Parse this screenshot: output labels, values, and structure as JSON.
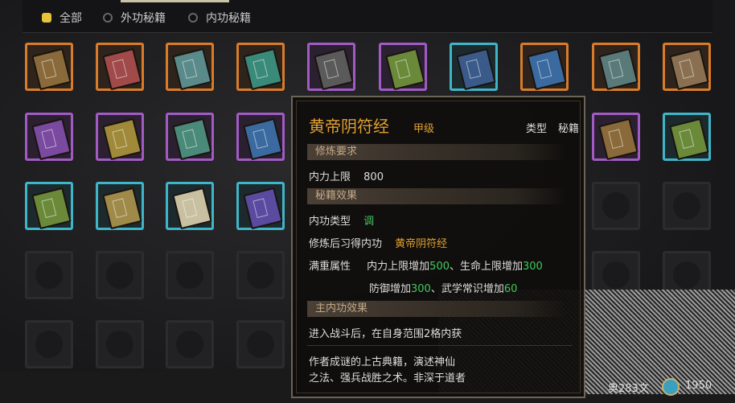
{
  "filters": [
    {
      "label": "全部",
      "active": true
    },
    {
      "label": "外功秘籍",
      "active": false
    },
    {
      "label": "内功秘籍",
      "active": false
    }
  ],
  "tooltip": {
    "title": "黄帝阴符经",
    "grade": "甲级",
    "type_label": "类型",
    "type_value": "秘籍",
    "sec_requirements": "修炼要求",
    "req_label": "内力上限",
    "req_value": "800",
    "sec_effects": "秘籍效果",
    "internal_type_label": "内功类型",
    "internal_type_value": "调",
    "learn_label": "修炼后习得内功",
    "learn_value": "黄帝阴符经",
    "full_label": "满重属性",
    "attr1_a": "内力上限增加",
    "attr1_v1": "500",
    "attr1_b": "、生命上限增加",
    "attr1_v2": "300",
    "attr2_a": "防御增加",
    "attr2_v1": "300",
    "attr2_b": "、武学常识增加",
    "attr2_v2": "60",
    "sec_main": "主内功效果",
    "main_effect": "进入战斗后，在自身范围2格内获",
    "desc_line1": "作者成谜的上古典籍，演述神仙",
    "desc_line2": "之法、强兵战胜之术。非深于道者"
  },
  "currency": {
    "cash": "奥283文",
    "coins": "1950"
  }
}
